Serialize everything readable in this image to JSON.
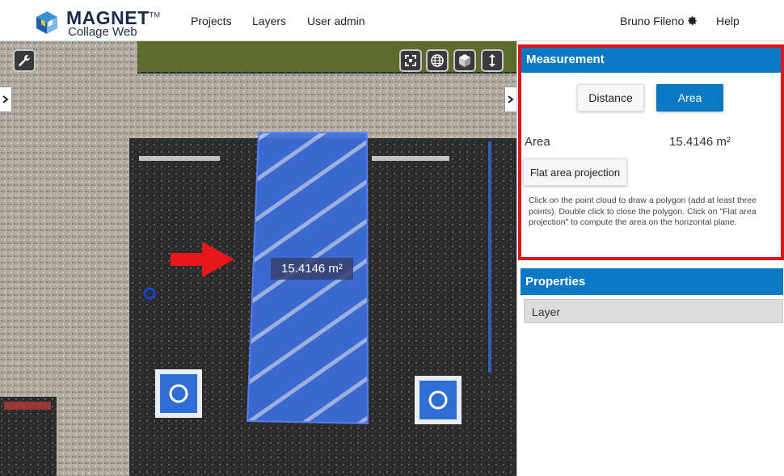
{
  "app": {
    "logo_name": "MAGNET",
    "logo_tm": "TM",
    "logo_sub": "Collage Web"
  },
  "nav": {
    "projects": "Projects",
    "layers": "Layers",
    "user_admin": "User admin",
    "user_name": "Bruno Fileno",
    "help": "Help"
  },
  "viewer": {
    "measurement_label": "15.4146 m²",
    "tools": [
      "wrench-icon",
      "fit-extent-icon",
      "globe-icon",
      "cube-icon",
      "vertical-arrows-icon"
    ]
  },
  "measurement": {
    "title": "Measurement",
    "distance_label": "Distance",
    "area_label": "Area",
    "result_label": "Area",
    "result_value": "15.4146 m²",
    "flat_button": "Flat area projection",
    "help": "Click on the point cloud to draw a polygon (add at least three points). Double click to close the polygon. Click on \"Flat area projection\" to compute the area on the horizontal plane."
  },
  "properties": {
    "title": "Properties",
    "layer_label": "Layer"
  },
  "colors": {
    "accent": "#0a78c2",
    "highlight_border": "#e0151b",
    "polygon_fill": "#3d6fe0"
  }
}
